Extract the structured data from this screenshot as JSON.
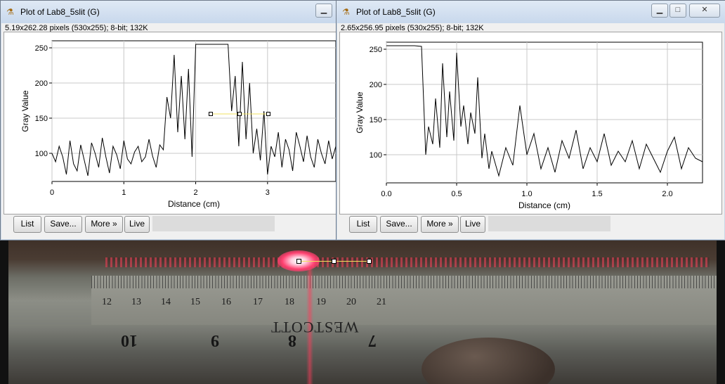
{
  "photo": {
    "ruler_numbers": [
      "12",
      "13",
      "14",
      "15",
      "16",
      "17",
      "18",
      "19",
      "20",
      "21"
    ],
    "big_numbers": [
      "10",
      "9",
      "8",
      "7"
    ],
    "brand_text": "WESTCOTT"
  },
  "colors": {
    "titlebar": "#c8d8ec",
    "selection": "#f0e060",
    "plot_line": "#000000"
  },
  "windows": [
    {
      "title": "Plot of Lab8_5slit (G)",
      "info": "5.19x262.28 pixels (530x255); 8-bit; 132K",
      "buttons": {
        "list": "List",
        "save": "Save...",
        "more": "More »",
        "live": "Live"
      },
      "controls": [
        "minimize-icon"
      ]
    },
    {
      "title": "Plot of Lab8_5slit (G)",
      "info": "2.65x256.95 pixels (530x255); 8-bit; 132K",
      "buttons": {
        "list": "List",
        "save": "Save...",
        "more": "More »",
        "live": "Live"
      },
      "controls": [
        "minimize-icon",
        "maximize-icon",
        "close-icon"
      ]
    }
  ],
  "chart_data": [
    {
      "type": "line",
      "xlabel": "Distance (cm)",
      "ylabel": "Gray Value",
      "xlim": [
        0,
        3.95
      ],
      "ylim": [
        60,
        260
      ],
      "xticks": [
        "0",
        "1",
        "2",
        "3"
      ],
      "yticks": [
        "100",
        "150",
        "200",
        "250"
      ],
      "grid": true,
      "x": [
        0,
        0.05,
        0.1,
        0.15,
        0.2,
        0.25,
        0.3,
        0.35,
        0.4,
        0.45,
        0.5,
        0.55,
        0.6,
        0.65,
        0.7,
        0.75,
        0.8,
        0.85,
        0.9,
        0.95,
        1.0,
        1.05,
        1.1,
        1.15,
        1.2,
        1.25,
        1.3,
        1.35,
        1.4,
        1.45,
        1.5,
        1.55,
        1.6,
        1.65,
        1.7,
        1.75,
        1.8,
        1.85,
        1.9,
        1.95,
        2.0,
        2.05,
        2.1,
        2.15,
        2.2,
        2.25,
        2.3,
        2.35,
        2.4,
        2.45,
        2.5,
        2.55,
        2.6,
        2.65,
        2.7,
        2.75,
        2.8,
        2.85,
        2.9,
        2.95,
        3.0,
        3.05,
        3.1,
        3.15,
        3.2,
        3.25,
        3.3,
        3.35,
        3.4,
        3.45,
        3.5,
        3.55,
        3.6,
        3.65,
        3.7,
        3.75,
        3.8,
        3.85,
        3.9,
        3.95
      ],
      "y": [
        100,
        88,
        110,
        95,
        70,
        118,
        85,
        75,
        112,
        90,
        68,
        115,
        100,
        80,
        122,
        95,
        72,
        110,
        98,
        78,
        118,
        92,
        85,
        102,
        110,
        88,
        95,
        120,
        96,
        80,
        112,
        105,
        180,
        150,
        240,
        130,
        210,
        120,
        220,
        95,
        255,
        255,
        255,
        255,
        255,
        255,
        255,
        255,
        255,
        255,
        160,
        210,
        110,
        230,
        120,
        200,
        100,
        135,
        90,
        160,
        70,
        110,
        95,
        130,
        80,
        120,
        105,
        75,
        130,
        110,
        88,
        125,
        95,
        80,
        120,
        100,
        85,
        118,
        92,
        110
      ]
    },
    {
      "type": "line",
      "xlabel": "Distance (cm)",
      "ylabel": "Gray Value",
      "xlim": [
        0,
        2.25
      ],
      "ylim": [
        60,
        260
      ],
      "xticks": [
        "0.0",
        "0.5",
        "1.0",
        "1.5",
        "2.0"
      ],
      "yticks": [
        "100",
        "150",
        "200",
        "250"
      ],
      "grid": true,
      "x": [
        0,
        0.05,
        0.1,
        0.15,
        0.2,
        0.25,
        0.28,
        0.3,
        0.33,
        0.35,
        0.38,
        0.4,
        0.43,
        0.45,
        0.48,
        0.5,
        0.53,
        0.55,
        0.58,
        0.6,
        0.63,
        0.65,
        0.68,
        0.7,
        0.73,
        0.75,
        0.8,
        0.85,
        0.9,
        0.95,
        1.0,
        1.05,
        1.1,
        1.15,
        1.2,
        1.25,
        1.3,
        1.35,
        1.4,
        1.45,
        1.5,
        1.55,
        1.6,
        1.65,
        1.7,
        1.75,
        1.8,
        1.85,
        1.9,
        1.95,
        2.0,
        2.05,
        2.1,
        2.15,
        2.2,
        2.25
      ],
      "y": [
        255,
        255,
        255,
        255,
        255,
        254,
        100,
        140,
        115,
        180,
        110,
        230,
        125,
        190,
        120,
        245,
        140,
        170,
        115,
        160,
        130,
        210,
        95,
        130,
        80,
        105,
        70,
        110,
        85,
        170,
        100,
        130,
        80,
        110,
        75,
        120,
        95,
        135,
        80,
        110,
        90,
        130,
        85,
        105,
        90,
        120,
        80,
        115,
        95,
        75,
        105,
        125,
        80,
        110,
        95,
        90
      ]
    }
  ]
}
